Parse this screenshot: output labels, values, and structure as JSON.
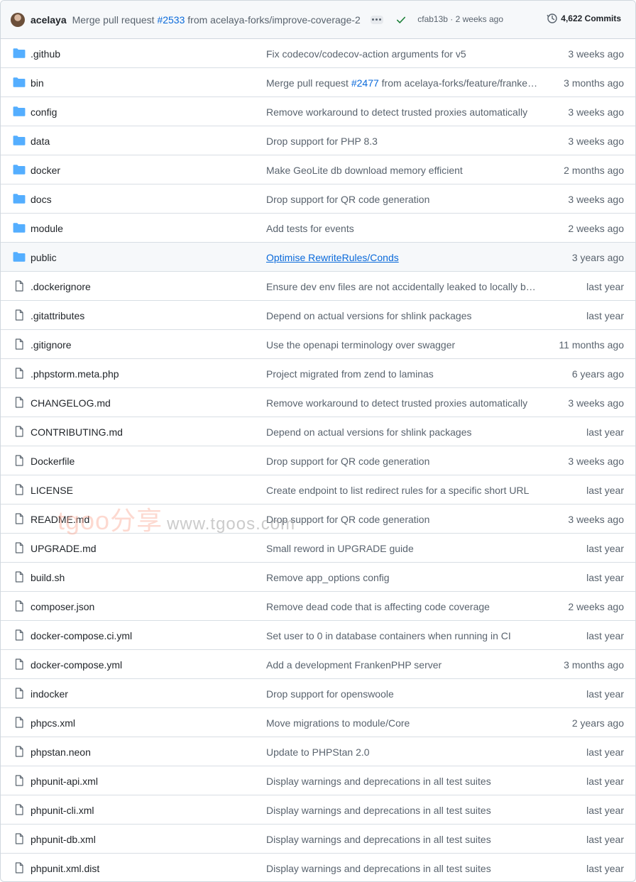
{
  "header": {
    "author": "acelaya",
    "message_prefix": "Merge pull request ",
    "message_link": "#2533",
    "message_suffix": " from acelaya-forks/improve-coverage-2",
    "sha_and_time": "cfab13b · 2 weeks ago",
    "commits": "4,622 Commits",
    "status_color": "#1a7f37"
  },
  "colors": {
    "folder": "#54aeff",
    "link": "#0969da",
    "muted": "#59636e"
  },
  "rows": [
    {
      "type": "folder",
      "name": ".github",
      "msg": "Fix codecov/codecov-action arguments for v5",
      "age": "3 weeks ago"
    },
    {
      "type": "folder",
      "name": "bin",
      "msg_prefix": "Merge pull request ",
      "msg_link": "#2477",
      "msg_suffix": " from acelaya-forks/feature/franke…",
      "age": "3 months ago"
    },
    {
      "type": "folder",
      "name": "config",
      "msg": "Remove workaround to detect trusted proxies automatically",
      "age": "3 weeks ago"
    },
    {
      "type": "folder",
      "name": "data",
      "msg": "Drop support for PHP 8.3",
      "age": "3 weeks ago"
    },
    {
      "type": "folder",
      "name": "docker",
      "msg": "Make GeoLite db download memory efficient",
      "age": "2 months ago"
    },
    {
      "type": "folder",
      "name": "docs",
      "msg": "Drop support for QR code generation",
      "age": "3 weeks ago"
    },
    {
      "type": "folder",
      "name": "module",
      "msg": "Add tests for events",
      "age": "2 weeks ago"
    },
    {
      "type": "folder",
      "name": "public",
      "msg": "Optimise RewriteRules/Conds",
      "age": "3 years ago",
      "highlight": true
    },
    {
      "type": "file",
      "name": ".dockerignore",
      "msg": "Ensure dev env files are not accidentally leaked to locally bui…",
      "age": "last year"
    },
    {
      "type": "file",
      "name": ".gitattributes",
      "msg": "Depend on actual versions for shlink packages",
      "age": "last year"
    },
    {
      "type": "file",
      "name": ".gitignore",
      "msg": "Use the openapi terminology over swagger",
      "age": "11 months ago"
    },
    {
      "type": "file",
      "name": ".phpstorm.meta.php",
      "msg": "Project migrated from zend to laminas",
      "age": "6 years ago"
    },
    {
      "type": "file",
      "name": "CHANGELOG.md",
      "msg": "Remove workaround to detect trusted proxies automatically",
      "age": "3 weeks ago"
    },
    {
      "type": "file",
      "name": "CONTRIBUTING.md",
      "msg": "Depend on actual versions for shlink packages",
      "age": "last year"
    },
    {
      "type": "file",
      "name": "Dockerfile",
      "msg": "Drop support for QR code generation",
      "age": "3 weeks ago"
    },
    {
      "type": "file",
      "name": "LICENSE",
      "msg": "Create endpoint to list redirect rules for a specific short URL",
      "age": "last year"
    },
    {
      "type": "file",
      "name": "README.md",
      "msg": "Drop support for QR code generation",
      "age": "3 weeks ago"
    },
    {
      "type": "file",
      "name": "UPGRADE.md",
      "msg": "Small reword in UPGRADE guide",
      "age": "last year"
    },
    {
      "type": "file",
      "name": "build.sh",
      "msg": "Remove app_options config",
      "age": "last year"
    },
    {
      "type": "file",
      "name": "composer.json",
      "msg": "Remove dead code that is affecting code coverage",
      "age": "2 weeks ago"
    },
    {
      "type": "file",
      "name": "docker-compose.ci.yml",
      "msg": "Set user to 0 in database containers when running in CI",
      "age": "last year"
    },
    {
      "type": "file",
      "name": "docker-compose.yml",
      "msg": "Add a development FrankenPHP server",
      "age": "3 months ago"
    },
    {
      "type": "file",
      "name": "indocker",
      "msg": "Drop support for openswoole",
      "age": "last year"
    },
    {
      "type": "file",
      "name": "phpcs.xml",
      "msg": "Move migrations to module/Core",
      "age": "2 years ago"
    },
    {
      "type": "file",
      "name": "phpstan.neon",
      "msg": "Update to PHPStan 2.0",
      "age": "last year"
    },
    {
      "type": "file",
      "name": "phpunit-api.xml",
      "msg": "Display warnings and deprecations in all test suites",
      "age": "last year"
    },
    {
      "type": "file",
      "name": "phpunit-cli.xml",
      "msg": "Display warnings and deprecations in all test suites",
      "age": "last year"
    },
    {
      "type": "file",
      "name": "phpunit-db.xml",
      "msg": "Display warnings and deprecations in all test suites",
      "age": "last year"
    },
    {
      "type": "file",
      "name": "phpunit.xml.dist",
      "msg": "Display warnings and deprecations in all test suites",
      "age": "last year"
    }
  ],
  "watermark": {
    "brand": "tgoo分享",
    "url": "www.tgoos.com"
  }
}
